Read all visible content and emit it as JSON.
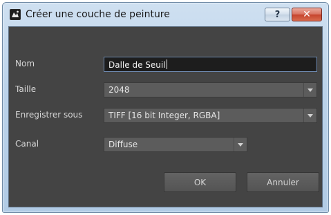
{
  "window": {
    "title": "Créer une couche de peinture",
    "help_label": "?",
    "close_label": "✕",
    "icon": "paint-layer-icon"
  },
  "form": {
    "name_label": "Nom",
    "name_value": "Dalle de Seuil",
    "size_label": "Taille",
    "size_value": "2048",
    "save_as_label": "Enregistrer sous",
    "save_as_value": "TIFF [16 bit Integer, RGBA]",
    "channel_label": "Canal",
    "channel_value": "Diffuse"
  },
  "buttons": {
    "ok_label": "OK",
    "cancel_label": "Annuler"
  },
  "colors": {
    "client_bg": "#444444",
    "input_bg": "#1d1d1d",
    "select_bg": "#5c5c5c",
    "close_red": "#c5432c"
  }
}
